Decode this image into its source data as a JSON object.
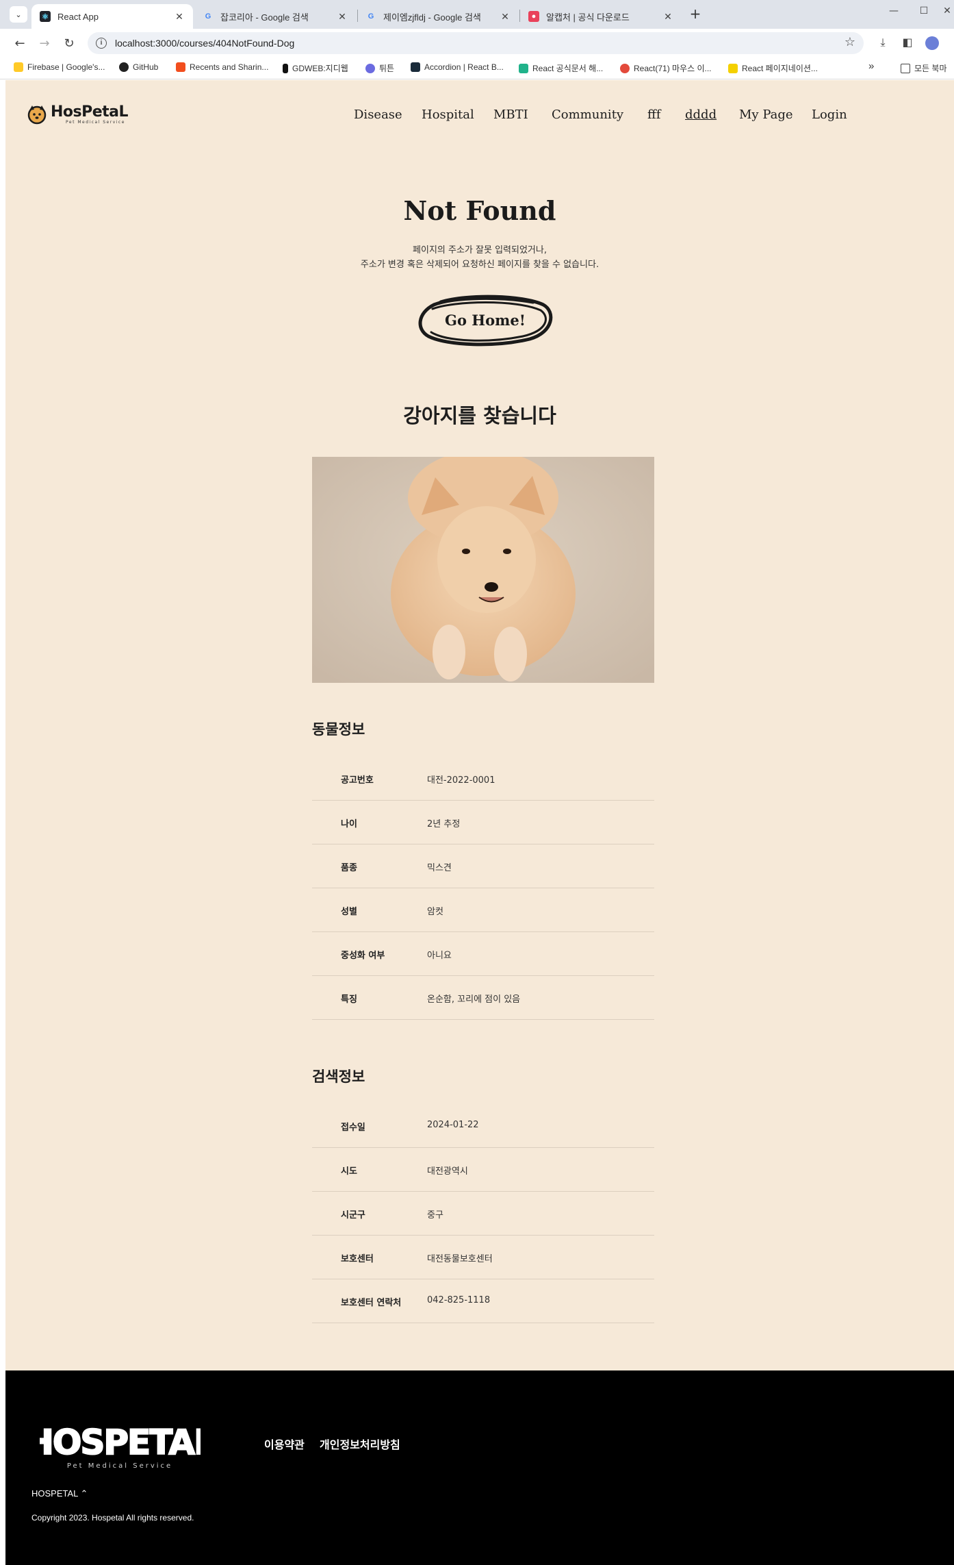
{
  "browser": {
    "tabs": [
      {
        "title": "React App",
        "close": "✕"
      },
      {
        "title": "잡코리아 - Google 검색",
        "close": "✕"
      },
      {
        "title": "제이엠zjfldj - Google 검색",
        "close": "✕"
      },
      {
        "title": "알캡처 | 공식 다운로드",
        "close": "✕"
      }
    ],
    "new_tab": "+",
    "url": "localhost:3000/courses/404NotFound-Dog",
    "bookmarks": [
      {
        "label": "Firebase | Google's..."
      },
      {
        "label": "GitHub"
      },
      {
        "label": "Recents and Sharin..."
      },
      {
        "label": "GDWEB:지디웹"
      },
      {
        "label": "튀튼"
      },
      {
        "label": "Accordion | React B..."
      },
      {
        "label": "React 공식문서 해..."
      },
      {
        "label": "React(71) 마우스 이..."
      },
      {
        "label": "React 페이지네이션..."
      }
    ],
    "bookmarks_more": "»",
    "all_bookmarks": "모든 북마"
  },
  "site": {
    "logo_text": "HosPetaL",
    "logo_sub": "Pet Medical Service",
    "nav": [
      "Disease",
      "Hospital",
      "MBTI",
      "Community",
      "fff",
      "dddd",
      "My Page",
      "Login"
    ]
  },
  "notfound": {
    "title": "Not Found",
    "line1": "페이지의 주소가 잘못 입력되었거나,",
    "line2": "주소가 변경 혹은 삭제되어 요청하신 페이지를 찾을 수 없습니다.",
    "button": "Go Home!"
  },
  "dog": {
    "heading": "강아지를 찾습니다",
    "animal_section": "동물정보",
    "animal_info": [
      {
        "key": "공고번호",
        "value": "대전-2022-0001"
      },
      {
        "key": "나이",
        "value": "2년 추정"
      },
      {
        "key": "품종",
        "value": "믹스견"
      },
      {
        "key": "성별",
        "value": "암컷"
      },
      {
        "key": "중성화 여부",
        "value": "아니요"
      },
      {
        "key": "특징",
        "value": "온순함, 꼬리에 점이 있음"
      }
    ],
    "search_section": "검색정보",
    "search_info": [
      {
        "key": "접수일",
        "value": "2024-01-22"
      },
      {
        "key": "시도",
        "value": "대전광역시"
      },
      {
        "key": "시군구",
        "value": "중구"
      },
      {
        "key": "보호센터",
        "value": "대전동물보호센터"
      },
      {
        "key": "보호센터 연락처",
        "value": "042-825-1118"
      }
    ]
  },
  "footer": {
    "logo_text": "HOSPETAL",
    "logo_sub": "Pet Medical Service",
    "links": [
      "이용약관",
      "개인정보처리방침"
    ],
    "brand": "HOSPETAL ⌃",
    "copyright": "Copyright 2023. Hospetal All rights reserved."
  }
}
